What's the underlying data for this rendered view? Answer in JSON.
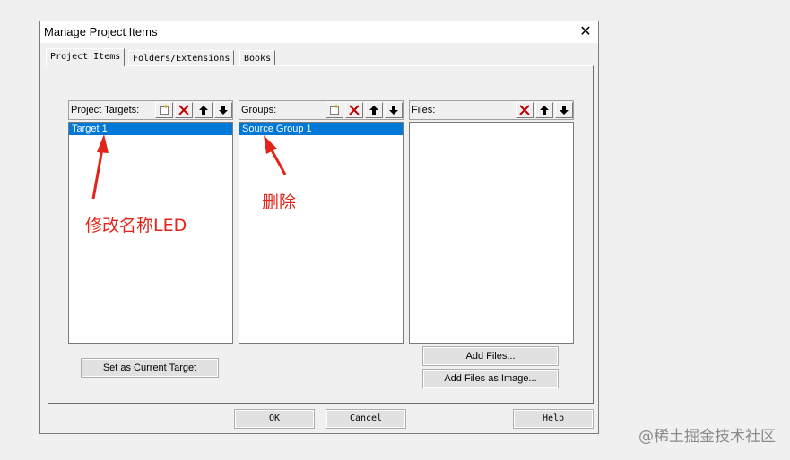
{
  "dialog": {
    "title": "Manage Project Items",
    "close_glyph": "✕"
  },
  "tabs": [
    {
      "label": "Project Items"
    },
    {
      "label": "Folders/Extensions"
    },
    {
      "label": "Books"
    }
  ],
  "project_targets": {
    "label": "Project Targets:",
    "items": [
      "Target 1"
    ]
  },
  "groups": {
    "label": "Groups:",
    "items": [
      "Source Group 1"
    ]
  },
  "files": {
    "label": "Files:",
    "items": []
  },
  "toolbar_icons": {
    "new": "new-icon",
    "delete": "delete-icon",
    "move_up": "arrow-up-icon",
    "move_down": "arrow-down-icon"
  },
  "buttons": {
    "set_current_target": "Set as Current Target",
    "add_files": "Add Files...",
    "add_files_image": "Add Files as Image...",
    "ok": "OK",
    "cancel": "Cancel",
    "help": "Help"
  },
  "annotations": {
    "rename": "修改名称LED",
    "delete": "删除"
  },
  "watermark": "@稀土掘金技术社区",
  "colors": {
    "selection": "#0078d7",
    "annotation": "#e3241b",
    "delete_x": "#c00000"
  }
}
